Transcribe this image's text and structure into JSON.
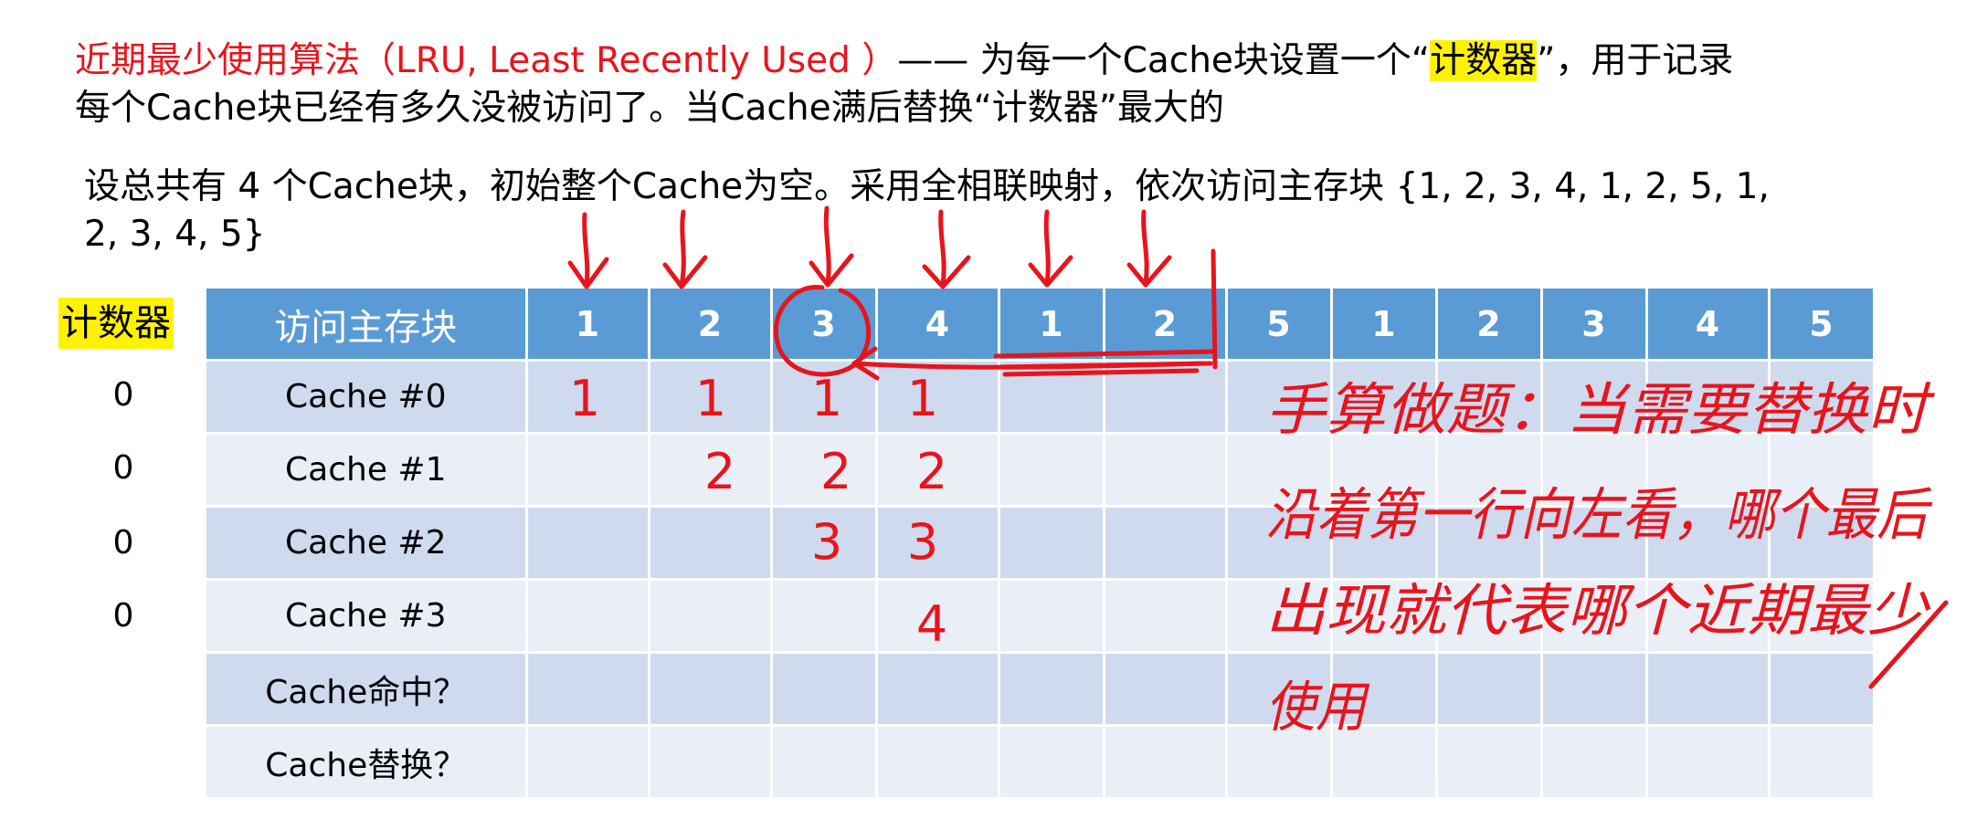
{
  "header": {
    "line1_red": "近期最少使用算法（LRU, Least Recently Used ）",
    "line1_dash": "—— 为每一个Cache块设置一个“",
    "line1_highlight": "计数器",
    "line1_end": "”，用于记录",
    "line2": "每个Cache块已经有多久没被访问了。当Cache满后替换“计数器”最大的"
  },
  "problem": {
    "line1": "设总共有 4 个Cache块，初始整个Cache为空。采用全相联映射，依次访问主存块 {1, 2, 3, 4, 1, 2, 5, 1,",
    "line2": "2, 3, 4, 5}"
  },
  "counter": {
    "label": "计数器",
    "values": [
      "0",
      "0",
      "0",
      "0"
    ]
  },
  "table": {
    "header_label": "访问主存块",
    "sequence": [
      "1",
      "2",
      "3",
      "4",
      "1",
      "2",
      "5",
      "1",
      "2",
      "3",
      "4",
      "5"
    ],
    "row_labels": [
      "Cache #0",
      "Cache #1",
      "Cache #2",
      "Cache #3",
      "Cache命中？",
      "Cache替换？"
    ]
  },
  "annotations": {
    "cell_marks": [
      {
        "row": 0,
        "col": 0,
        "text": "1"
      },
      {
        "row": 0,
        "col": 1,
        "text": "1"
      },
      {
        "row": 0,
        "col": 2,
        "text": "1"
      },
      {
        "row": 0,
        "col": 3,
        "text": "1"
      },
      {
        "row": 1,
        "col": 1,
        "text": "2"
      },
      {
        "row": 1,
        "col": 2,
        "text": "2"
      },
      {
        "row": 1,
        "col": 3,
        "text": "2"
      },
      {
        "row": 2,
        "col": 2,
        "text": "3"
      },
      {
        "row": 2,
        "col": 3,
        "text": "3"
      },
      {
        "row": 3,
        "col": 3,
        "text": "4"
      }
    ],
    "note_lines": [
      "手算做题：当需要替换时",
      "沿着第一行向左看，哪个最后",
      "出现就代表哪个近期最少",
      "使用"
    ],
    "ink_color": "#e8141c"
  }
}
